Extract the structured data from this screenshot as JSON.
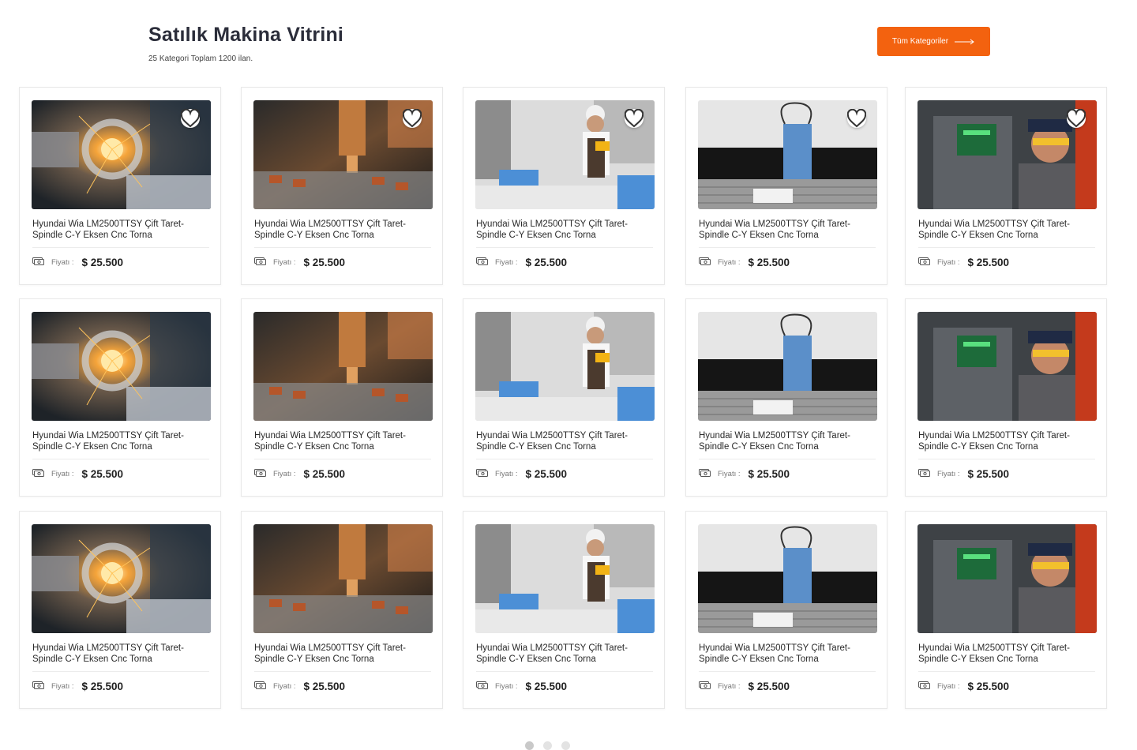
{
  "header": {
    "title": "Satılık Makina Vitrini",
    "subtitle": "25 Kategori Toplam 1200 ilan.",
    "all_categories_label": "Tüm Kategoriler"
  },
  "price_label": "Fiyatı :",
  "listings": [
    {
      "name": "Hyundai Wia LM2500TTSY Çift Taret-Spindle C-Y Eksen Cnc Torna",
      "price": "$ 25.500",
      "image": "lathe-sparks",
      "favorite": true
    },
    {
      "name": "Hyundai Wia LM2500TTSY Çift Taret-Spindle C-Y Eksen Cnc Torna",
      "price": "$ 25.500",
      "image": "cnc-spindle",
      "favorite": true
    },
    {
      "name": "Hyundai Wia LM2500TTSY Çift Taret-Spindle C-Y Eksen Cnc Torna",
      "price": "$ 25.500",
      "image": "worker-plasma",
      "favorite": true
    },
    {
      "name": "Hyundai Wia LM2500TTSY Çift Taret-Spindle C-Y Eksen Cnc Torna",
      "price": "$ 25.500",
      "image": "plasma-cutter",
      "favorite": true
    },
    {
      "name": "Hyundai Wia LM2500TTSY Çift Taret-Spindle C-Y Eksen Cnc Torna",
      "price": "$ 25.500",
      "image": "operator",
      "favorite": true
    },
    {
      "name": "Hyundai Wia LM2500TTSY Çift Taret-Spindle C-Y Eksen Cnc Torna",
      "price": "$ 25.500",
      "image": "lathe-sparks",
      "favorite": false
    },
    {
      "name": "Hyundai Wia LM2500TTSY Çift Taret-Spindle C-Y Eksen Cnc Torna",
      "price": "$ 25.500",
      "image": "cnc-spindle",
      "favorite": false
    },
    {
      "name": "Hyundai Wia LM2500TTSY Çift Taret-Spindle C-Y Eksen Cnc Torna",
      "price": "$ 25.500",
      "image": "worker-plasma",
      "favorite": false
    },
    {
      "name": "Hyundai Wia LM2500TTSY Çift Taret-Spindle C-Y Eksen Cnc Torna",
      "price": "$ 25.500",
      "image": "plasma-cutter",
      "favorite": false
    },
    {
      "name": "Hyundai Wia LM2500TTSY Çift Taret-Spindle C-Y Eksen Cnc Torna",
      "price": "$ 25.500",
      "image": "operator",
      "favorite": false
    },
    {
      "name": "Hyundai Wia LM2500TTSY Çift Taret-Spindle C-Y Eksen Cnc Torna",
      "price": "$ 25.500",
      "image": "lathe-sparks",
      "favorite": false
    },
    {
      "name": "Hyundai Wia LM2500TTSY Çift Taret-Spindle C-Y Eksen Cnc Torna",
      "price": "$ 25.500",
      "image": "cnc-spindle",
      "favorite": false
    },
    {
      "name": "Hyundai Wia LM2500TTSY Çift Taret-Spindle C-Y Eksen Cnc Torna",
      "price": "$ 25.500",
      "image": "worker-plasma",
      "favorite": false
    },
    {
      "name": "Hyundai Wia LM2500TTSY Çift Taret-Spindle C-Y Eksen Cnc Torna",
      "price": "$ 25.500",
      "image": "plasma-cutter",
      "favorite": false
    },
    {
      "name": "Hyundai Wia LM2500TTSY Çift Taret-Spindle C-Y Eksen Cnc Torna",
      "price": "$ 25.500",
      "image": "operator",
      "favorite": false
    }
  ],
  "pagination": {
    "pages": 3,
    "active": 0
  },
  "colors": {
    "accent": "#f3620f",
    "text": "#2b2d3a",
    "border": "#e8e8e8"
  }
}
